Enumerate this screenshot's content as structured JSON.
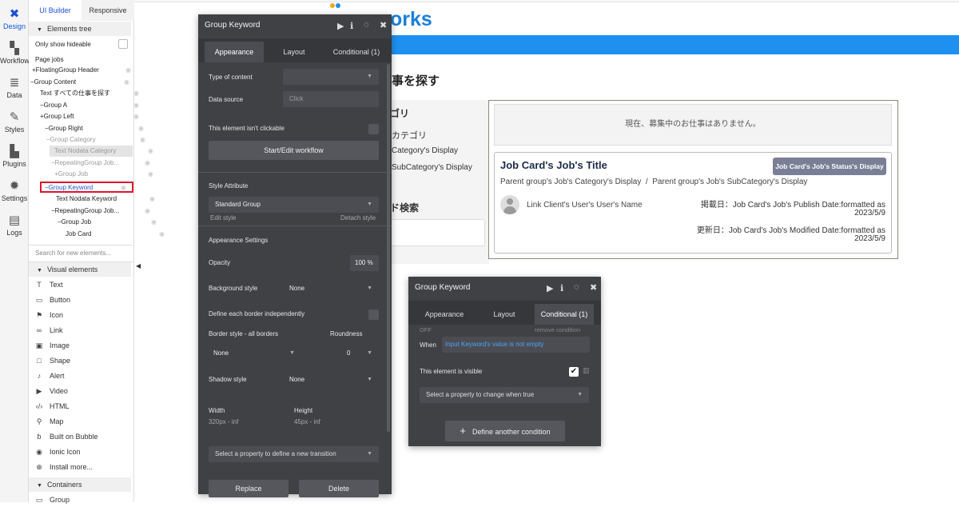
{
  "rail": {
    "items": [
      {
        "label": "Design",
        "icon": "design-icon"
      },
      {
        "label": "Workflow",
        "icon": "workflow-icon"
      },
      {
        "label": "Data",
        "icon": "data-icon"
      },
      {
        "label": "Styles",
        "icon": "styles-icon"
      },
      {
        "label": "Plugins",
        "icon": "plugins-icon"
      },
      {
        "label": "Settings",
        "icon": "settings-icon"
      },
      {
        "label": "Logs",
        "icon": "logs-icon"
      }
    ]
  },
  "panel": {
    "tabs": [
      "UI Builder",
      "Responsive"
    ],
    "elements_tree": "Elements tree",
    "only_hideable": "Only show hideable",
    "tree": [
      "Page jobs",
      "+FloatingGroup Header",
      "−Group Content",
      "Text すべての仕事を探す",
      "−Group A",
      "+Group Left",
      "−Group Right",
      "−Group Category",
      "Text Nodata Category",
      "−RepeatingGroup Job...",
      "+Group Job",
      "−Group Keyword",
      "Text Nodata Keyword",
      "−RepeatingGroup Job...",
      "−Group Job",
      "Job Card"
    ],
    "search_placeholder": "Search for new elements...",
    "visual_elements": "Visual elements",
    "elements": [
      "Text",
      "Button",
      "Icon",
      "Link",
      "Image",
      "Shape",
      "Alert",
      "Video",
      "HTML",
      "Map",
      "Built on Bubble",
      "Ionic Icon",
      "Install more..."
    ],
    "containers": "Containers",
    "container_first": "Group"
  },
  "canvas": {
    "logo": "orks",
    "heading": "事を探す",
    "category_title": "ゴリ",
    "category_item": "カテゴリ",
    "category_display": "Category's Display",
    "subcategory_display": "SubCategory's Display",
    "keyword_title": "ド検索",
    "nodata": "現在、募集中のお仕事はありません。",
    "card": {
      "title": "Job Card's Job's Title",
      "badge": "Job Card's Job's Status's Display",
      "categories": "Parent group's Job's Category's Display  /  Parent group's Job's SubCategory's Display",
      "client": "Link Client's User's User's Name",
      "published_line1": "掲載日：Job Card's Job's Publish Date:formatted as",
      "published_line2": "2023/5/9",
      "modified_line1": "更新日：Job Card's Job's Modified Date:formatted as",
      "modified_line2": "2023/5/9"
    },
    "blue_bar_color": "#1e90f0",
    "accent_color": "#1d7fd8"
  },
  "editor": {
    "title": "Group Keyword",
    "tabs": [
      "Appearance",
      "Layout",
      "Conditional (1)"
    ],
    "type_of_content": "Type of content",
    "data_source": "Data source",
    "data_source_placeholder": "Click",
    "not_clickable": "This element isn't clickable",
    "start_edit_workflow": "Start/Edit workflow",
    "style_attribute": "Style Attribute",
    "style_value": "Standard Group",
    "edit_style": "Edit style",
    "detach_style": "Detach style",
    "appearance_settings": "Appearance Settings",
    "opacity": "Opacity",
    "opacity_value": "100 %",
    "background_style": "Background style",
    "background_value": "None",
    "define_border": "Define each border independently",
    "border_style": "Border style - all borders",
    "roundness": "Roundness",
    "border_value": "None",
    "roundness_value": "0",
    "shadow_style": "Shadow style",
    "shadow_value": "None",
    "width_label": "Width",
    "width_value": "320px - inf",
    "height_label": "Height",
    "height_value": "45px - inf",
    "transition_placeholder": "Select a property to define a new transition",
    "replace": "Replace",
    "delete": "Delete"
  },
  "conditional": {
    "title": "Group Keyword",
    "tabs": [
      "Appearance",
      "Layout",
      "Conditional (1)"
    ],
    "off": "OFF",
    "remove": "remove condition",
    "when": "When",
    "expression": "Input Keyword's value is not empty",
    "visible": "This element is visible",
    "property_placeholder": "Select a property to change when true",
    "define_another": "Define another condition"
  }
}
